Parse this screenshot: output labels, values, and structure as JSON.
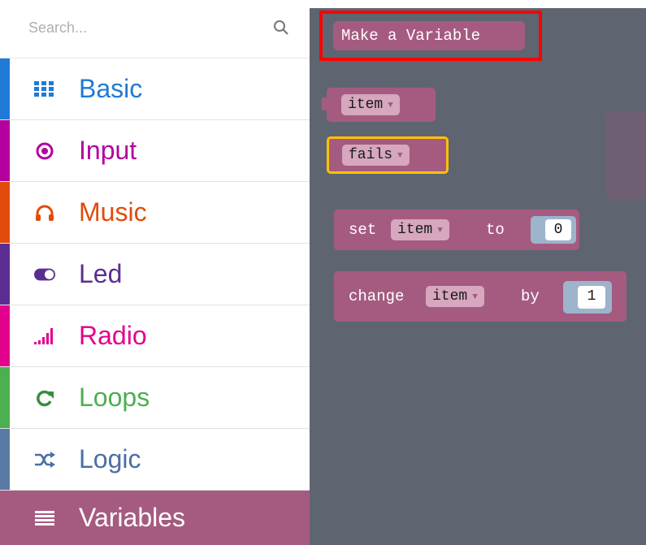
{
  "search": {
    "placeholder": "Search..."
  },
  "categories": [
    {
      "label": "Basic",
      "icon": "grid-icon",
      "color": "#1e7ad6"
    },
    {
      "label": "Input",
      "icon": "target-icon",
      "color": "#b4009e"
    },
    {
      "label": "Music",
      "icon": "headphones-icon",
      "color": "#e14b0e"
    },
    {
      "label": "Led",
      "icon": "toggle-icon",
      "color": "#5c2d91"
    },
    {
      "label": "Radio",
      "icon": "signal-bars-icon",
      "color": "#e3008c"
    },
    {
      "label": "Loops",
      "icon": "loop-arrow-icon",
      "color": "#4caf50"
    },
    {
      "label": "Logic",
      "icon": "shuffle-icon",
      "color": "#5a7aa6"
    },
    {
      "label": "Variables",
      "icon": "list-icon",
      "color": "#a55b80"
    }
  ],
  "workspace": {
    "make_variable": "Make a Variable",
    "var_item": "item",
    "var_fails": "fails",
    "set_block": {
      "prefix": "set",
      "var": "item",
      "mid": "to",
      "value": "0"
    },
    "change_block": {
      "prefix": "change",
      "var": "item",
      "mid": "by",
      "value": "1"
    },
    "dropdown_arrow": "▼"
  },
  "colors": {
    "variables": "#a55b80",
    "workspace_bg": "#5f6570",
    "highlight": "#ff0000",
    "selected_outline": "#ffc107"
  }
}
